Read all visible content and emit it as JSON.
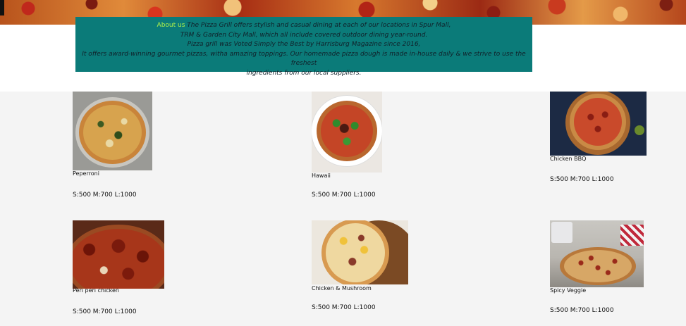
{
  "about": {
    "label": "About us",
    "line1": "The Pizza Grill offers stylish and casual dining at each of our locations in Spur Mall,",
    "line2": "TRM & Garden City Mall, which all include covered outdoor dining year-round.",
    "line3": "Pizza grill was Voted Simply the Best by Harrisburg Magazine since 2016,",
    "line4": "It offers award-winning gourmet pizzas, witha amazing toppings. Our homemade pizza dough is made in-house daily & we strive to use the freshest",
    "line5": "ingredients from our local suppliers."
  },
  "menu": [
    {
      "name": "Peperroni",
      "price": "S:500 M:700 L:1000"
    },
    {
      "name": "Hawaii",
      "price": "S:500 M:700 L:1000"
    },
    {
      "name": "Chicken BBQ",
      "price": "S:500 M:700 L:1000"
    },
    {
      "name": "Peri peri chicken",
      "price": "S:500 M:700 L:1000"
    },
    {
      "name": "Chicken & Mushroom",
      "price": "S:500 M:700 L:1000"
    },
    {
      "name": "Spicy Veggie",
      "price": "S:500 M:700 L:1000"
    }
  ]
}
